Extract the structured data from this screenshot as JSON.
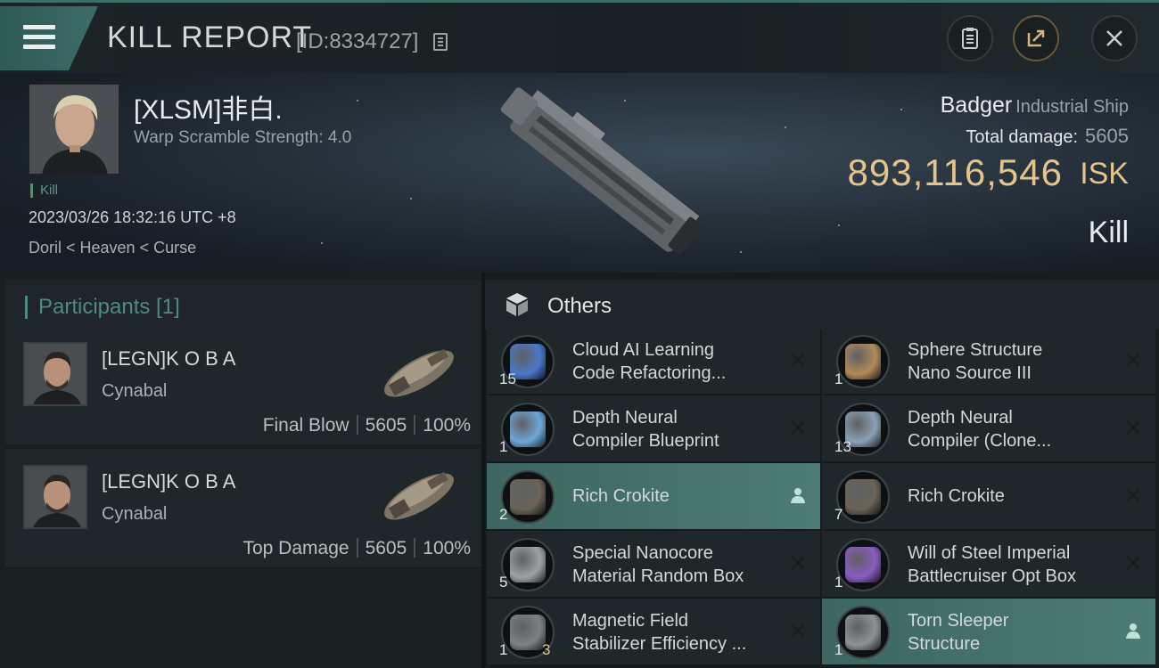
{
  "header": {
    "title": "KILL REPORT",
    "report_id": "[ID:8334727]"
  },
  "victim": {
    "name": "[XLSM]非白.",
    "warp_scramble": "Warp Scramble Strength: 4.0",
    "kill_tag": "Kill",
    "timestamp": "2023/03/26 18:32:16 UTC +8",
    "location": "Doril < Heaven < Curse",
    "ship_name": "Badger",
    "ship_class": "Industrial Ship",
    "total_damage_label": "Total damage:",
    "total_damage_value": "5605",
    "isk_value": "893,116,546",
    "isk_unit": "ISK",
    "result": "Kill"
  },
  "participants": {
    "title": "Participants [1]",
    "rows": [
      {
        "name": "[LEGN]K O B A",
        "ship": "Cynabal",
        "role": "Final Blow",
        "damage": "5605",
        "percent": "100%"
      },
      {
        "name": "[LEGN]K O B A",
        "ship": "Cynabal",
        "role": "Top Damage",
        "damage": "5605",
        "percent": "100%"
      }
    ]
  },
  "others": {
    "title": "Others",
    "items": [
      {
        "line1": "Cloud AI Learning",
        "line2": "Code Refactoring...",
        "qty": "15",
        "status": "destroyed",
        "color": "#4a78c8"
      },
      {
        "line1": "Sphere Structure",
        "line2": "Nano Source III",
        "qty": "1",
        "status": "destroyed",
        "color": "#b08a5a"
      },
      {
        "line1": "Depth Neural",
        "line2": "Compiler Blueprint",
        "qty": "1",
        "status": "destroyed",
        "color": "#6fa6d8"
      },
      {
        "line1": "Depth Neural",
        "line2": "Compiler (Clone...",
        "qty": "13",
        "status": "destroyed",
        "color": "#8aa0b4"
      },
      {
        "line1": "Rich Crokite",
        "line2": "",
        "qty": "2",
        "status": "dropped",
        "color": "#6b6358"
      },
      {
        "line1": "Rich Crokite",
        "line2": "",
        "qty": "7",
        "status": "destroyed",
        "color": "#6b6358"
      },
      {
        "line1": "Special Nanocore",
        "line2": "Material Random Box",
        "qty": "5",
        "status": "destroyed",
        "color": "#9ea2a6"
      },
      {
        "line1": "Will of Steel Imperial",
        "line2": "Battlecruiser Opt Box",
        "qty": "1",
        "status": "destroyed",
        "color": "#8a5cc2"
      },
      {
        "line1": "Magnetic Field",
        "line2": "Stabilizer Efficiency ...",
        "qty": "1",
        "extra": "3",
        "status": "destroyed",
        "color": "#7d8184"
      },
      {
        "line1": "Torn Sleeper",
        "line2": "Structure",
        "qty": "1",
        "status": "dropped",
        "color": "#8e9296"
      }
    ]
  }
}
